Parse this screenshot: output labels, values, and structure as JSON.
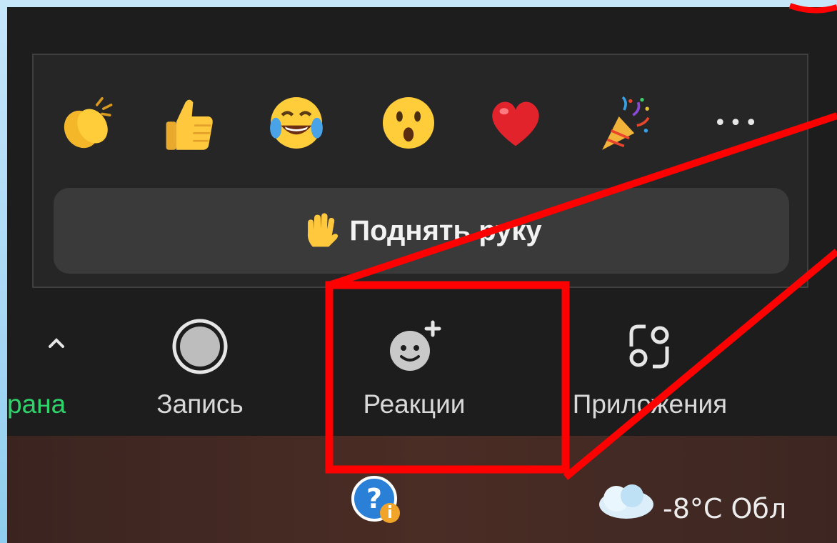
{
  "reactions_panel": {
    "emojis": [
      {
        "name": "clapping-hands-icon"
      },
      {
        "name": "thumbs-up-icon"
      },
      {
        "name": "tears-of-joy-icon"
      },
      {
        "name": "surprised-face-icon"
      },
      {
        "name": "red-heart-icon"
      },
      {
        "name": "party-popper-icon"
      }
    ],
    "more_label": "•••",
    "raise_hand_label": "Поднять руку"
  },
  "toolbar": {
    "share_label": "рана",
    "record_label": "Запись",
    "reactions_label": "Реакции",
    "apps_label": "Приложения"
  },
  "taskbar": {
    "weather_text": "-8°C  Обл"
  },
  "colors": {
    "accent_green": "#2fd36b",
    "highlight_red": "#ff0000"
  }
}
